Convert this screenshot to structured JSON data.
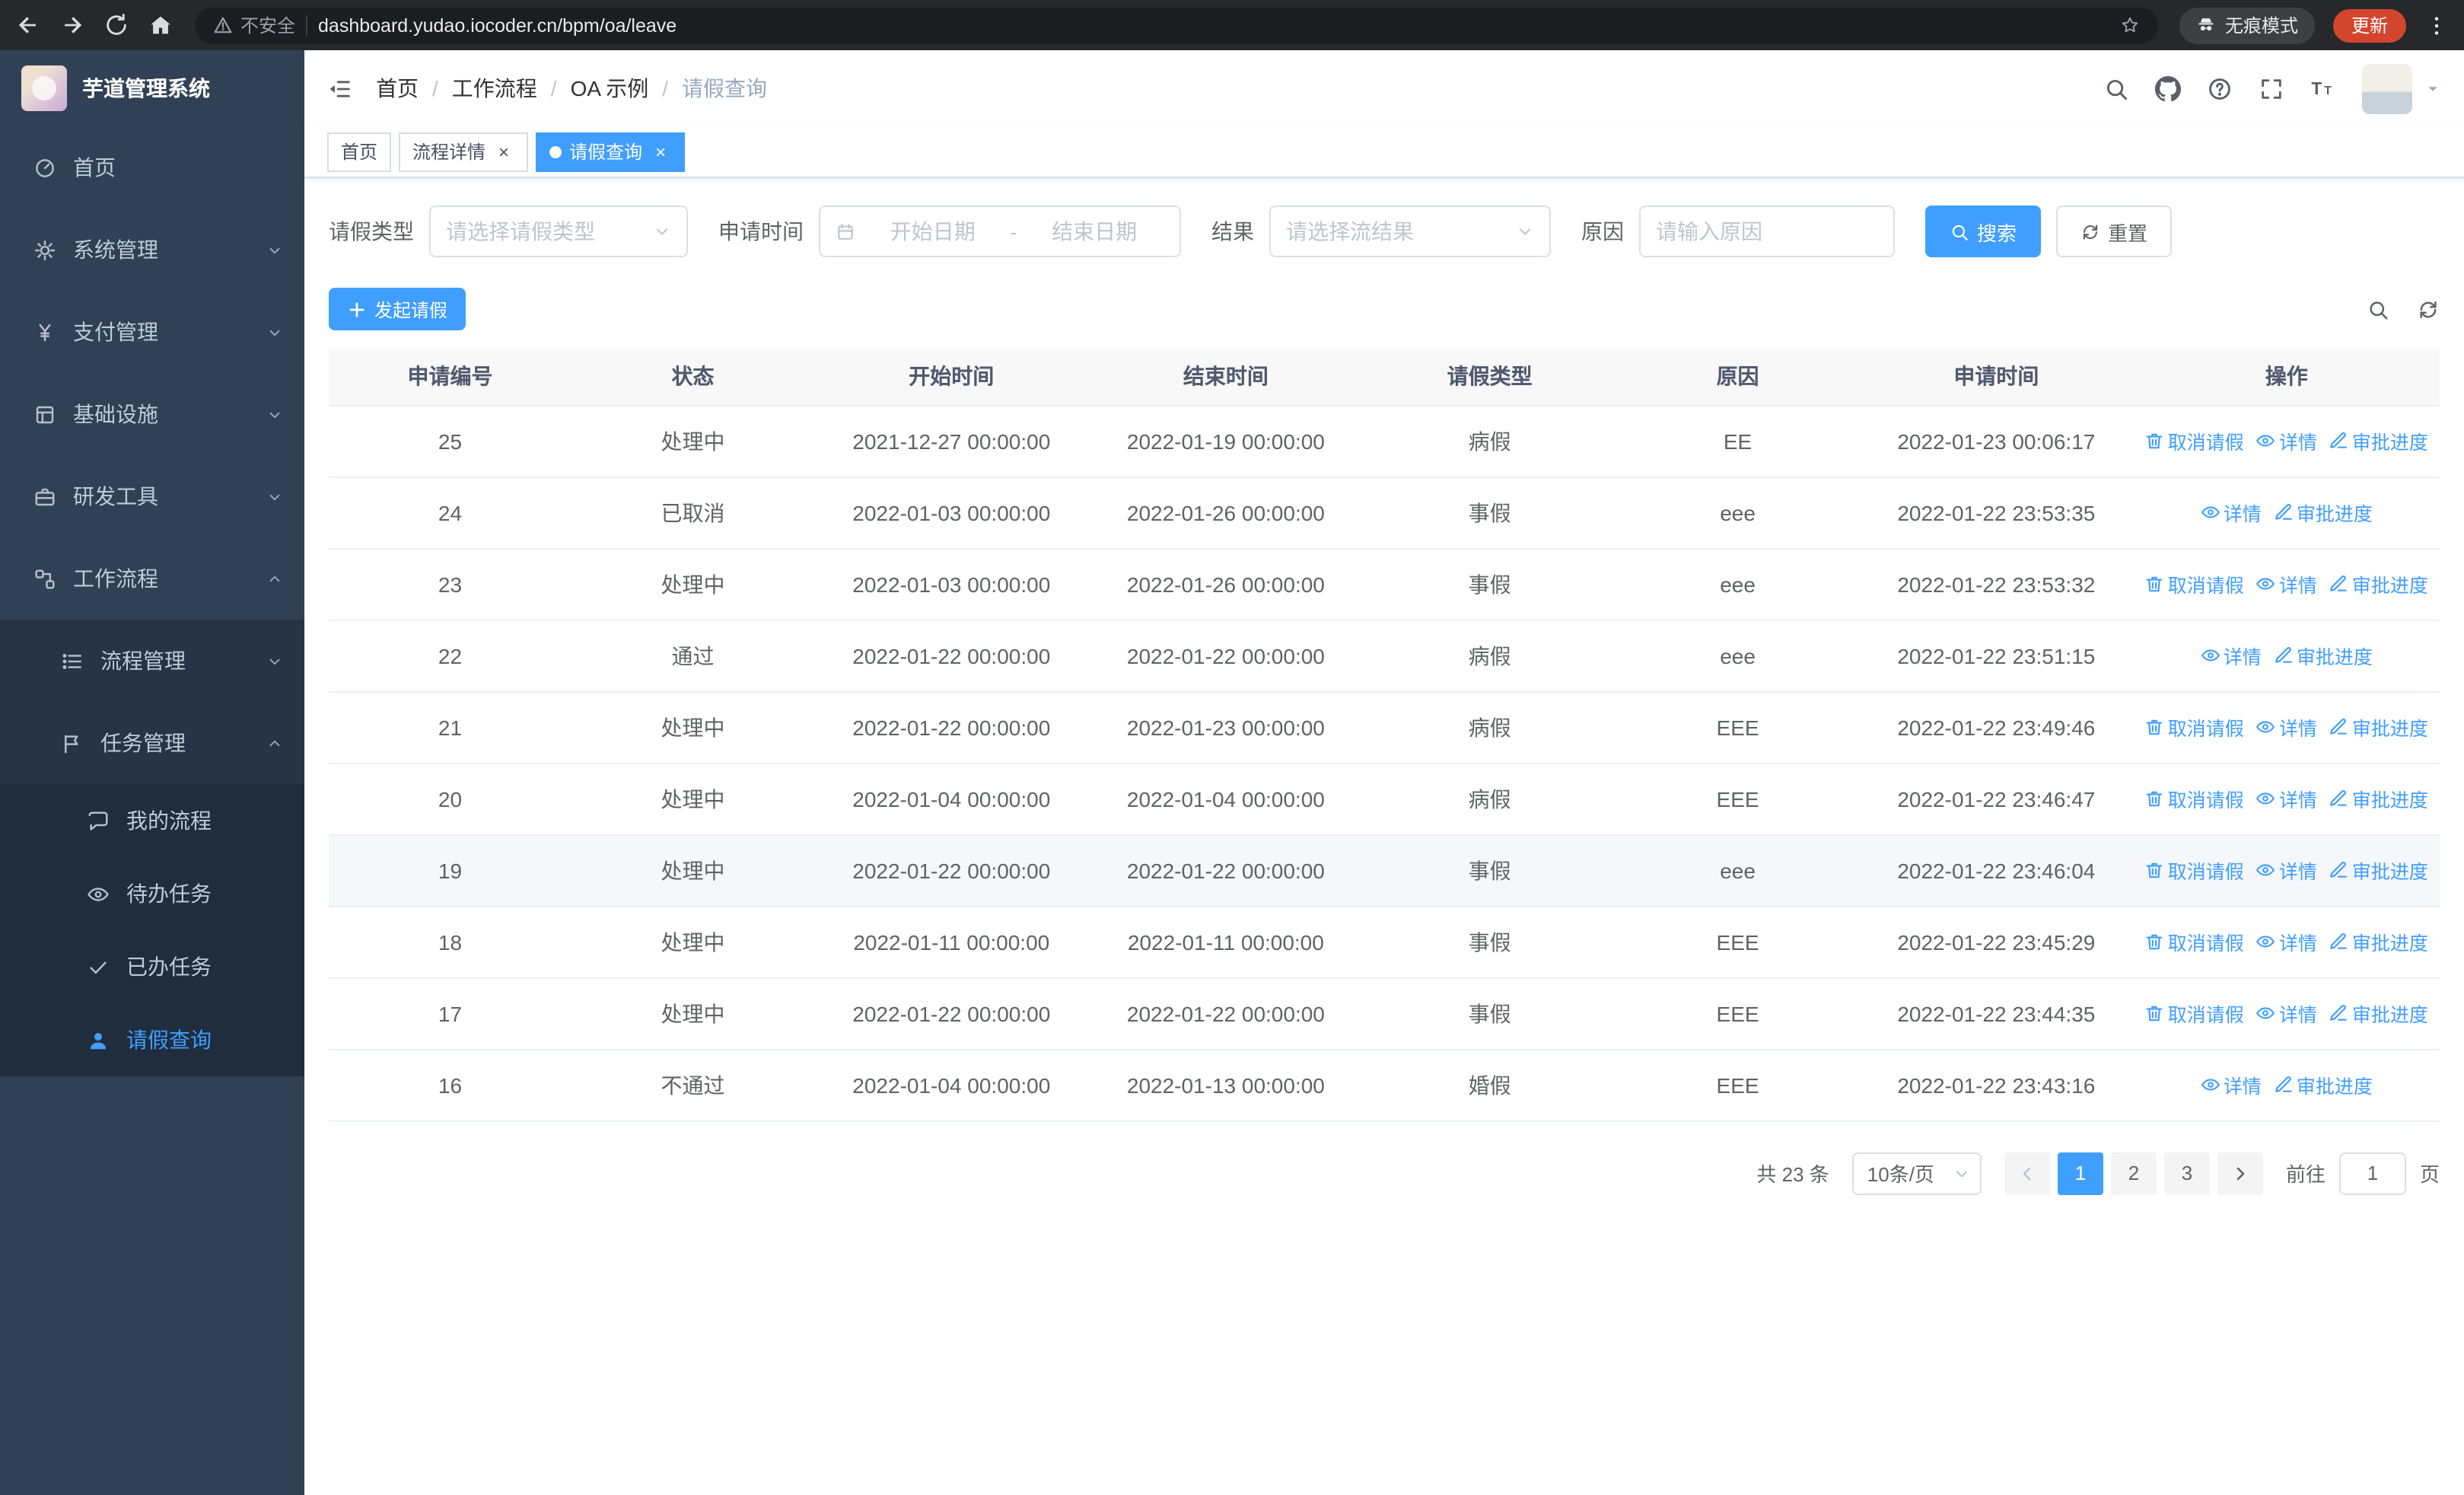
{
  "browser": {
    "security_label": "不安全",
    "url": "dashboard.yudao.iocoder.cn/bpm/oa/leave",
    "incognito_label": "无痕模式",
    "update_label": "更新"
  },
  "colors": {
    "accent": "#409eff",
    "sidebar_bg": "#304156",
    "sidebar_submenu_bg": "#263445",
    "sidebar_nested_bg": "#1f2d3d",
    "update_pill": "#d4452e",
    "table_header_bg": "#f8f8f9"
  },
  "sidebar": {
    "app_title": "芋道管理系统",
    "menu": [
      {
        "key": "home",
        "label": "首页",
        "icon": "dashboard",
        "level": 1
      },
      {
        "key": "system-management",
        "label": "系统管理",
        "icon": "gear",
        "level": 1,
        "expandable": true
      },
      {
        "key": "payment-management",
        "label": "支付管理",
        "icon": "yen",
        "level": 1,
        "expandable": true
      },
      {
        "key": "infrastructure",
        "label": "基础设施",
        "icon": "window",
        "level": 1,
        "expandable": true
      },
      {
        "key": "dev-tools",
        "label": "研发工具",
        "icon": "briefcase",
        "level": 1,
        "expandable": true
      },
      {
        "key": "workflow",
        "label": "工作流程",
        "icon": "flow",
        "level": 1,
        "expandable": true,
        "expanded": true
      },
      {
        "key": "process-management",
        "label": "流程管理",
        "icon": "list",
        "level": 2,
        "expandable": true
      },
      {
        "key": "task-management",
        "label": "任务管理",
        "icon": "flag",
        "level": 2,
        "expandable": true,
        "expanded": true
      },
      {
        "key": "my-process",
        "label": "我的流程",
        "icon": "chat",
        "level": 3
      },
      {
        "key": "todo-tasks",
        "label": "待办任务",
        "icon": "eye",
        "level": 3
      },
      {
        "key": "done-tasks",
        "label": "已办任务",
        "icon": "check",
        "level": 3
      },
      {
        "key": "leave-query",
        "label": "请假查询",
        "icon": "user",
        "level": 3,
        "active": true
      }
    ]
  },
  "header": {
    "breadcrumb": [
      "首页",
      "工作流程",
      "OA 示例",
      "请假查询"
    ],
    "action_icons": [
      "search",
      "github",
      "question",
      "fullscreen",
      "font-size",
      "avatar",
      "caret-down"
    ]
  },
  "tabs": [
    {
      "key": "home",
      "label": "首页",
      "closable": false,
      "active": false
    },
    {
      "key": "process-detail",
      "label": "流程详情",
      "closable": true,
      "active": false
    },
    {
      "key": "leave-query",
      "label": "请假查询",
      "closable": true,
      "active": true
    }
  ],
  "filters": {
    "leave_type_label": "请假类型",
    "leave_type_placeholder": "请选择请假类型",
    "apply_time_label": "申请时间",
    "start_date_placeholder": "开始日期",
    "range_separator": "-",
    "end_date_placeholder": "结束日期",
    "result_label": "结果",
    "result_placeholder": "请选择流结果",
    "reason_label": "原因",
    "reason_placeholder": "请输入原因",
    "search_button": "搜索",
    "reset_button": "重置"
  },
  "toolbar": {
    "create_button": "发起请假",
    "right_icons": [
      "search",
      "refresh"
    ]
  },
  "table": {
    "columns": [
      "申请编号",
      "状态",
      "开始时间",
      "结束时间",
      "请假类型",
      "原因",
      "申请时间",
      "操作"
    ],
    "action_labels": {
      "cancel": {
        "label": "取消请假",
        "icon": "delete"
      },
      "detail": {
        "label": "详情",
        "icon": "view"
      },
      "progress": {
        "label": "审批进度",
        "icon": "edit"
      }
    },
    "rows": [
      {
        "id": "25",
        "status": "处理中",
        "start": "2021-12-27 00:00:00",
        "end": "2022-01-19 00:00:00",
        "type": "病假",
        "reason": "EE",
        "applied": "2022-01-23 00:06:17",
        "actions": [
          "cancel",
          "detail",
          "progress"
        ]
      },
      {
        "id": "24",
        "status": "已取消",
        "start": "2022-01-03 00:00:00",
        "end": "2022-01-26 00:00:00",
        "type": "事假",
        "reason": "eee",
        "applied": "2022-01-22 23:53:35",
        "actions": [
          "detail",
          "progress"
        ]
      },
      {
        "id": "23",
        "status": "处理中",
        "start": "2022-01-03 00:00:00",
        "end": "2022-01-26 00:00:00",
        "type": "事假",
        "reason": "eee",
        "applied": "2022-01-22 23:53:32",
        "actions": [
          "cancel",
          "detail",
          "progress"
        ]
      },
      {
        "id": "22",
        "status": "通过",
        "start": "2022-01-22 00:00:00",
        "end": "2022-01-22 00:00:00",
        "type": "病假",
        "reason": "eee",
        "applied": "2022-01-22 23:51:15",
        "actions": [
          "detail",
          "progress"
        ]
      },
      {
        "id": "21",
        "status": "处理中",
        "start": "2022-01-22 00:00:00",
        "end": "2022-01-23 00:00:00",
        "type": "病假",
        "reason": "EEE",
        "applied": "2022-01-22 23:49:46",
        "actions": [
          "cancel",
          "detail",
          "progress"
        ]
      },
      {
        "id": "20",
        "status": "处理中",
        "start": "2022-01-04 00:00:00",
        "end": "2022-01-04 00:00:00",
        "type": "病假",
        "reason": "EEE",
        "applied": "2022-01-22 23:46:47",
        "actions": [
          "cancel",
          "detail",
          "progress"
        ]
      },
      {
        "id": "19",
        "status": "处理中",
        "start": "2022-01-22 00:00:00",
        "end": "2022-01-22 00:00:00",
        "type": "事假",
        "reason": "eee",
        "applied": "2022-01-22 23:46:04",
        "actions": [
          "cancel",
          "detail",
          "progress"
        ],
        "highlighted": true
      },
      {
        "id": "18",
        "status": "处理中",
        "start": "2022-01-11 00:00:00",
        "end": "2022-01-11 00:00:00",
        "type": "事假",
        "reason": "EEE",
        "applied": "2022-01-22 23:45:29",
        "actions": [
          "cancel",
          "detail",
          "progress"
        ]
      },
      {
        "id": "17",
        "status": "处理中",
        "start": "2022-01-22 00:00:00",
        "end": "2022-01-22 00:00:00",
        "type": "事假",
        "reason": "EEE",
        "applied": "2022-01-22 23:44:35",
        "actions": [
          "cancel",
          "detail",
          "progress"
        ]
      },
      {
        "id": "16",
        "status": "不通过",
        "start": "2022-01-04 00:00:00",
        "end": "2022-01-13 00:00:00",
        "type": "婚假",
        "reason": "EEE",
        "applied": "2022-01-22 23:43:16",
        "actions": [
          "detail",
          "progress"
        ]
      }
    ]
  },
  "pagination": {
    "total_label": "共 23 条",
    "page_size": "10条/页",
    "pages": [
      "1",
      "2",
      "3"
    ],
    "active_page": "1",
    "goto_label": "前往",
    "goto_value": "1",
    "goto_suffix": "页"
  }
}
